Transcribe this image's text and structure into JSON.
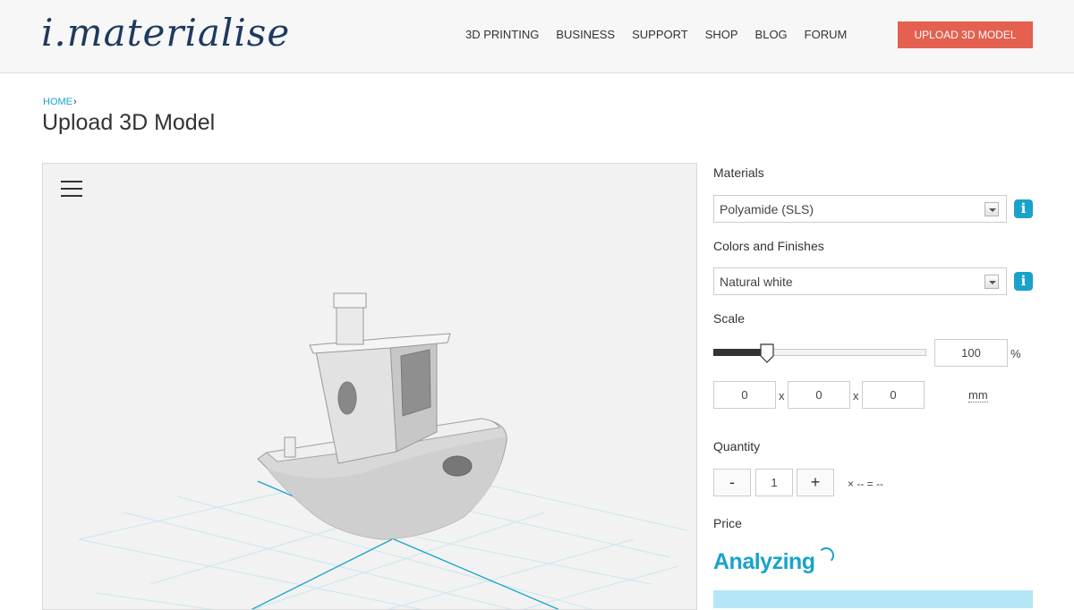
{
  "header": {
    "logo_text": "i.materialise",
    "nav": [
      "3D PRINTING",
      "BUSINESS",
      "SUPPORT",
      "SHOP",
      "BLOG",
      "FORUM"
    ],
    "upload_button": "UPLOAD 3D MODEL"
  },
  "breadcrumb": {
    "home": "HOME",
    "separator": "›"
  },
  "page_title": "Upload 3D Model",
  "viewer": {
    "menu_icon": "hamburger-icon"
  },
  "panel": {
    "materials_label": "Materials",
    "material_value": "Polyamide (SLS)",
    "colors_label": "Colors and Finishes",
    "color_value": "Natural white",
    "scale_label": "Scale",
    "scale_percent": 100,
    "scale_value": "100",
    "scale_unit": "%",
    "dim_x": "0",
    "dim_y": "0",
    "dim_z": "0",
    "dim_sep": "x",
    "dim_unit": "mm",
    "quantity_label": "Quantity",
    "qty_minus": "-",
    "qty_value": "1",
    "qty_plus": "+",
    "qty_total": "× -- = --",
    "price_label": "Price",
    "analyzing": "Analyzing",
    "info_icon": "i"
  },
  "colors": {
    "accent": "#1aa3c9",
    "cta": "#e4604f",
    "logo": "#1f3a5f"
  }
}
